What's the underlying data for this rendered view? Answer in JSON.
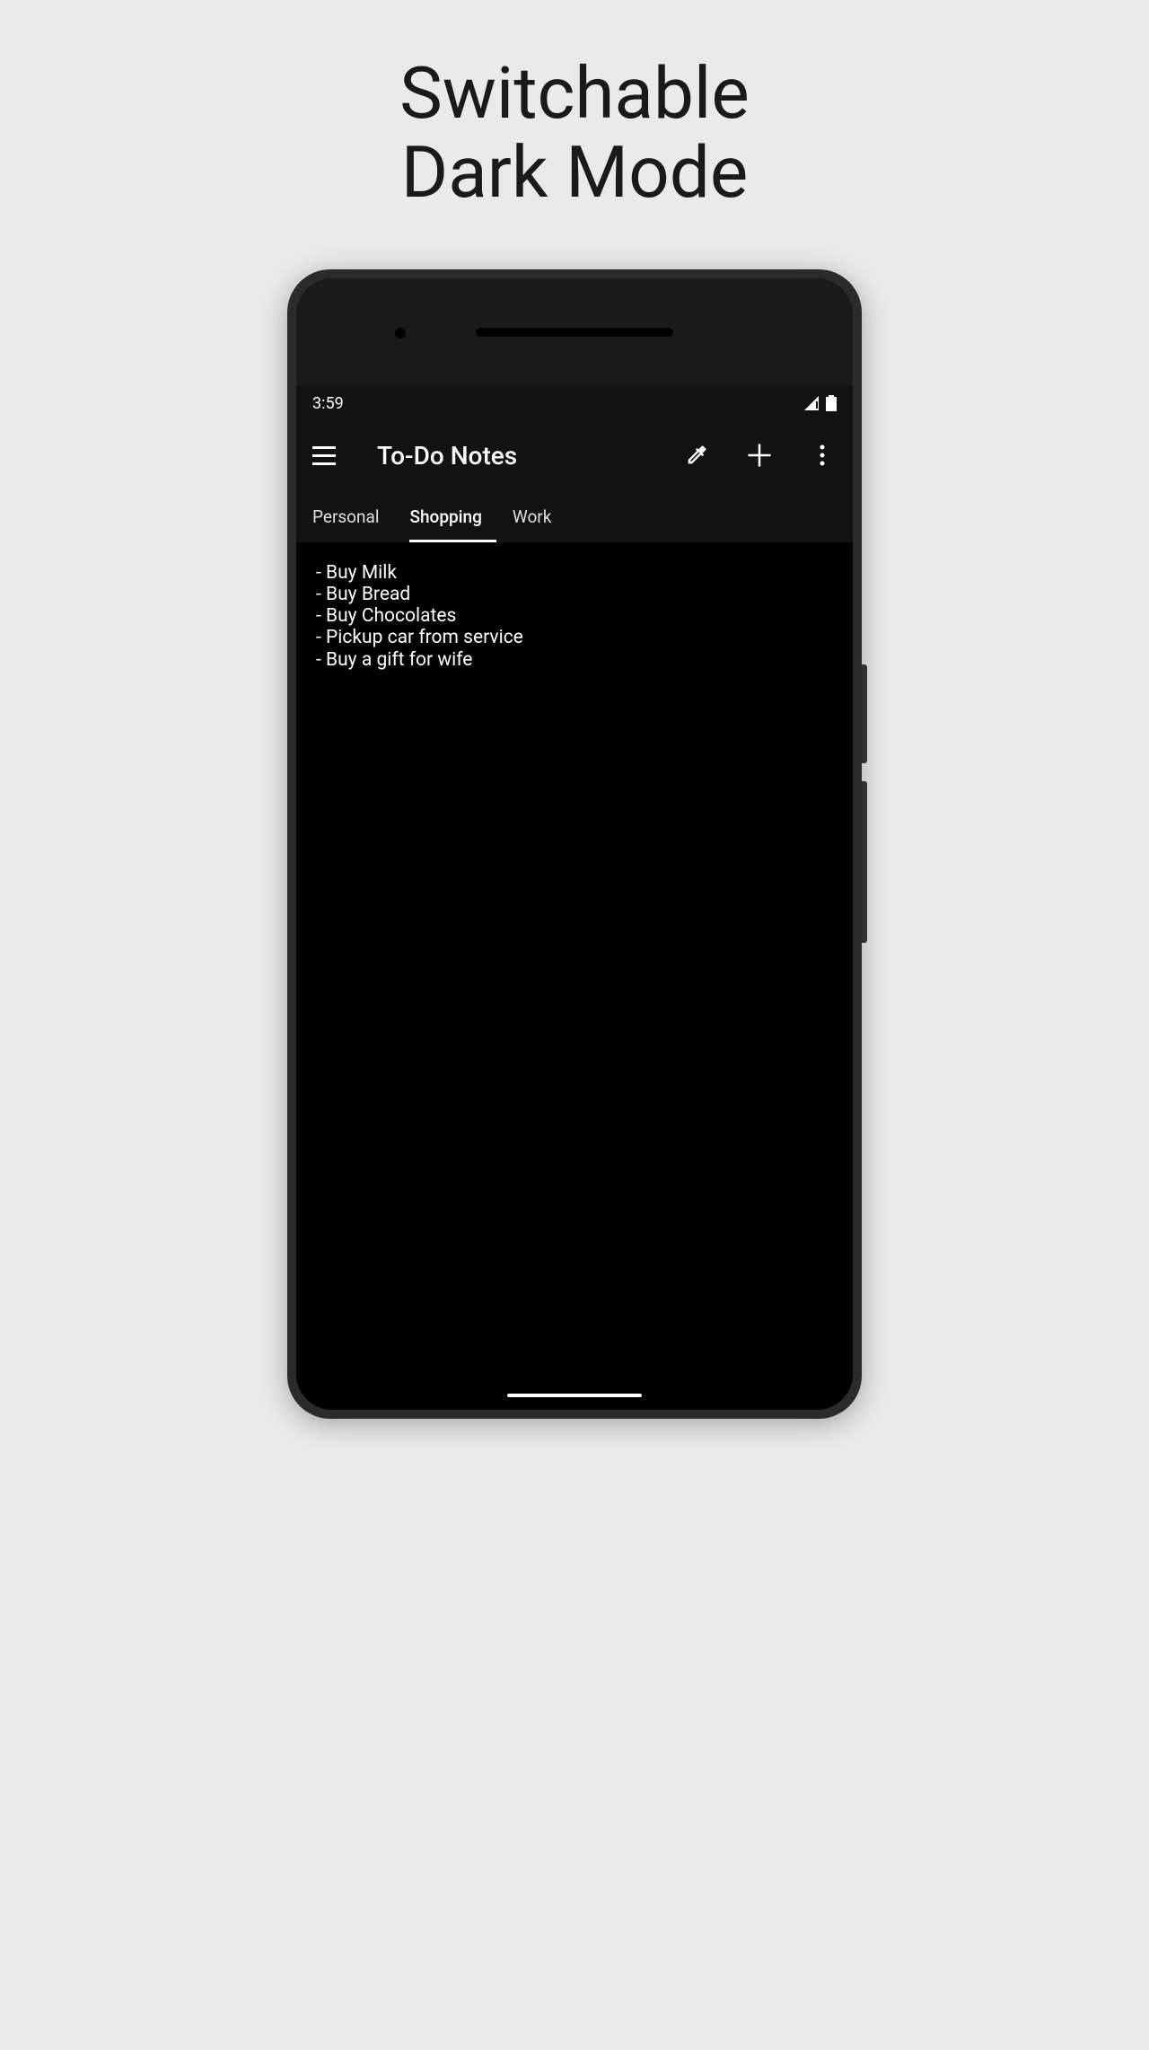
{
  "promo": {
    "line1": "Switchable",
    "line2": "Dark Mode"
  },
  "status": {
    "time": "3:59"
  },
  "header": {
    "title": "To-Do Notes"
  },
  "tabs": [
    {
      "label": "Personal",
      "active": false
    },
    {
      "label": "Shopping",
      "active": true
    },
    {
      "label": "Work",
      "active": false
    }
  ],
  "note": {
    "lines": [
      "- Buy Milk",
      "- Buy Bread",
      "- Buy Chocolates",
      "- Pickup car from service",
      "- Buy a gift for wife"
    ]
  }
}
